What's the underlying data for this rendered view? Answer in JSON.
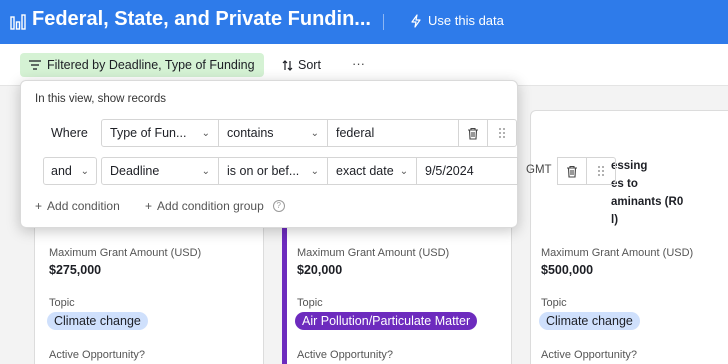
{
  "header": {
    "title": "Federal, State, and Private Fundin...",
    "use_data": "Use this data",
    "bg_color": "#2e7bea"
  },
  "toolbar": {
    "filter_label": "Filtered by Deadline, Type of Funding",
    "sort_label": "Sort",
    "more_label": "···",
    "filter_color": "#d5f2d4"
  },
  "filter_popup": {
    "heading": "In this view, show records",
    "rows": [
      {
        "conjunction": "Where",
        "field": "Type of Fun...",
        "operator": "contains",
        "value": "federal"
      },
      {
        "conjunction": "and",
        "field": "Deadline",
        "operator": "is on or bef...",
        "mode": "exact date",
        "value": "9/5/2024",
        "timezone": "GMT"
      }
    ],
    "add_condition": "Add condition",
    "add_condition_group": "Add condition group"
  },
  "cards": [
    {
      "max_label": "Maximum Grant Amount (USD)",
      "max_value": "$275,000",
      "topic_label": "Topic",
      "topic": "Climate change",
      "topic_color": "#cfe0fc",
      "active_label": "Active Opportunity?"
    },
    {
      "max_label": "Maximum Grant Amount (USD)",
      "max_value": "$20,000",
      "topic_label": "Topic",
      "topic": "Air Pollution/Particulate Matter",
      "topic_color": "#6d2bbe",
      "active_label": "Active Opportunity?"
    },
    {
      "max_label": "Maximum Grant Amount (USD)",
      "max_value": "$500,000",
      "topic_label": "Topic",
      "topic": "Climate change",
      "topic_color": "#cfe0fc",
      "active_label": "Active Opportunity?",
      "peek_lines": [
        "essing",
        "es to",
        "aminants (R0",
        "l)"
      ]
    }
  ]
}
